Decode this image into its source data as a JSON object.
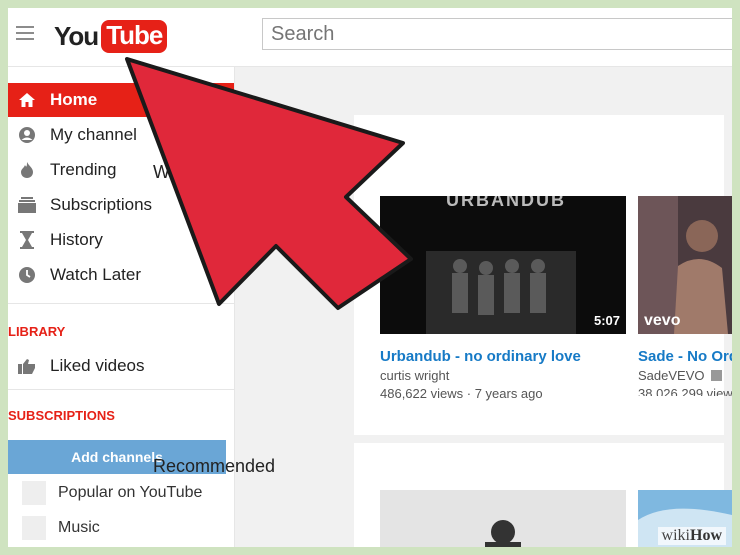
{
  "header": {
    "logo_you": "You",
    "logo_tube": "Tube",
    "search_placeholder": "Search"
  },
  "sidebar": {
    "items": [
      {
        "label": "Home",
        "icon": "home-icon"
      },
      {
        "label": "My channel",
        "icon": "person-icon"
      },
      {
        "label": "Trending",
        "icon": "flame-icon"
      },
      {
        "label": "Subscriptions",
        "icon": "subscriptions-icon"
      },
      {
        "label": "History",
        "icon": "hourglass-icon"
      },
      {
        "label": "Watch Later",
        "icon": "clock-icon"
      }
    ],
    "library_heading": "LIBRARY",
    "library_items": [
      {
        "label": "Liked videos",
        "icon": "thumbs-up-icon"
      }
    ],
    "subscriptions_heading": "SUBSCRIPTIONS",
    "add_channels_label": "Add channels",
    "subscription_items": [
      {
        "label": "Popular on YouTube"
      },
      {
        "label": "Music"
      }
    ]
  },
  "main": {
    "watch_again_title": "Watch It Again",
    "recommended_title": "Recommended",
    "videos": [
      {
        "title": "Urbandub - no ordinary love",
        "channel": "curtis wright",
        "views": "486,622 views",
        "age": "7 years ago",
        "duration": "5:07",
        "thumb_text": "URBANDUB"
      },
      {
        "title": "Sade - No Ord",
        "channel": "SadeVEVO",
        "views": "38,026,299 view",
        "thumb_text": "vevo"
      }
    ]
  },
  "watermark": {
    "wiki": "wiki",
    "how": "How"
  },
  "colors": {
    "accent": "#e62117",
    "link": "#167ac6",
    "button": "#6aa6d6",
    "arrow": "#e0283a",
    "frame": "#cfe3c0"
  }
}
